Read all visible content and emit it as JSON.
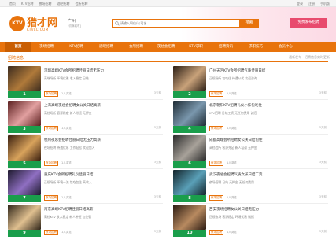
{
  "topbar": {
    "links": [
      "首页",
      "KTV招聘",
      "夜场招聘",
      "酒吧招聘",
      "会所招聘"
    ],
    "right": [
      "登录",
      "注册",
      "手机版"
    ]
  },
  "logo": {
    "name": "猎才网",
    "sub": "KTVLC.COM",
    "mark": "KTV"
  },
  "city": {
    "name": "广州",
    "sub": "[切换城市]"
  },
  "search": {
    "placeholder": "请输入职位/公司名",
    "button": "搜索"
  },
  "publish": {
    "label": "免费发布招聘"
  },
  "nav": {
    "items": [
      "首页",
      "夜场招聘",
      "KTV招聘",
      "酒吧招聘",
      "会所招聘",
      "夜总会招聘",
      "KTV求职",
      "招聘资讯",
      "求职技巧",
      "会员中心"
    ],
    "active_index": 0
  },
  "section": {
    "title": "招聘信息",
    "ticker": "最新发布 · 招聘信息实时更新"
  },
  "cards": [
    {
      "title": "深圳高端KTV会所招聘佳丽日结无压力",
      "desc": "高端场所 环境优雅 收入稳定 日结",
      "tag": "1",
      "pill": "夜场招聘",
      "viewed": "1人浏览",
      "date": "3天前",
      "colors": [
        "#3b2b1e",
        "#b07a3a"
      ]
    },
    {
      "title": "广州天河KTV会所招聘气质佳丽日结",
      "desc": "正规场所 包吃住 待遇从优 欢迎咨询",
      "tag": "2",
      "pill": "夜场招聘",
      "viewed": "1人浏览",
      "date": "3天前",
      "colors": [
        "#2a1d14",
        "#c9a27a"
      ]
    },
    {
      "title": "上海高端夜总会招聘女公关日结高薪",
      "desc": "高档场所 客源稳定 新人带班 无押金",
      "tag": "3",
      "pill": "夜场招聘",
      "viewed": "1人浏览",
      "date": "3天前",
      "colors": [
        "#5a1e1e",
        "#e2a0a0"
      ]
    },
    {
      "title": "北京朝阳KTV招聘礼仪小妹包吃住",
      "desc": "KTV招聘 日结工资 无任何费用 诚招",
      "tag": "4",
      "pill": "夜场招聘",
      "viewed": "1人浏览",
      "date": "3天前",
      "colors": [
        "#1d2a33",
        "#7a97ad"
      ]
    },
    {
      "title": "杭州夜总会招聘佳丽日结无压力高薪",
      "desc": "夜场招聘 待遇优厚 工作轻松 欢迎加入",
      "tag": "5",
      "pill": "夜场招聘",
      "viewed": "1人浏览",
      "date": "3天前",
      "colors": [
        "#3a1f0f",
        "#d9a35c"
      ]
    },
    {
      "title": "成都高端会所招聘女公关日结包住",
      "desc": "高档会所 客源充足 新人培训 无押金",
      "tag": "6",
      "pill": "夜场招聘",
      "viewed": "1人浏览",
      "date": "3天前",
      "colors": [
        "#2b2b2b",
        "#a8a29a"
      ]
    },
    {
      "title": "重庆KTV会所招聘礼仪佳丽日结",
      "desc": "正规场所 环境一流 包吃包住 高收入",
      "tag": "7",
      "pill": "夜场招聘",
      "viewed": "1人浏览",
      "date": "3天前",
      "colors": [
        "#1e1a2e",
        "#8f6fc2"
      ]
    },
    {
      "title": "武汉夜总会招聘气质女孩日结工资",
      "desc": "夜场招聘 日结 无押金 无任何费用",
      "tag": "8",
      "pill": "夜场招聘",
      "viewed": "1人浏览",
      "date": "3天前",
      "colors": [
        "#12232a",
        "#5aa0b8"
      ]
    },
    {
      "title": "南京高端KTV招聘佳丽日结高薪",
      "desc": "高档KTV 收入稳定 新人带班 包住宿",
      "tag": "9",
      "pill": "夜场招聘",
      "viewed": "1人浏览",
      "date": "3天前",
      "colors": [
        "#2e2418",
        "#e0c090"
      ]
    },
    {
      "title": "西安夜场招聘女公关日结无压力",
      "desc": "正规夜场 客源稳定 环境优雅 诚招",
      "tag": "10",
      "pill": "夜场招聘",
      "viewed": "1人浏览",
      "date": "3天前",
      "colors": [
        "#2a1a12",
        "#b88a60"
      ]
    }
  ]
}
